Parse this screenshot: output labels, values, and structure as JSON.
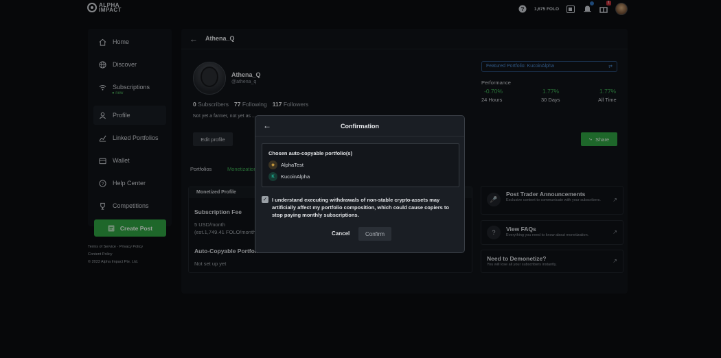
{
  "brand": {
    "line1": "ALPHA",
    "line2": "IMPACT"
  },
  "topbar": {
    "balance": "1,675 FOLO",
    "bell_badge": "1",
    "help_icon": "help-circle-icon",
    "wallet_icon": "wallet-icon",
    "notifications_icon": "bell-icon",
    "gift_icon": "gift-icon"
  },
  "sidebar": {
    "items": [
      {
        "label": "Home",
        "icon": "home-icon"
      },
      {
        "label": "Discover",
        "icon": "globe-icon"
      },
      {
        "label": "Subscriptions",
        "icon": "wifi-icon",
        "sub": "● new"
      },
      {
        "label": "Profile",
        "icon": "user-icon"
      },
      {
        "label": "Linked Portfolios",
        "icon": "chart-line-icon"
      },
      {
        "label": "Wallet",
        "icon": "wallet-icon"
      },
      {
        "label": "Help Center",
        "icon": "help-circle-icon"
      },
      {
        "label": "Competitions",
        "icon": "trophy-icon"
      }
    ],
    "create_post": "Create Post",
    "footer": {
      "terms": "Terms of Service",
      "privacy": "Privacy Policy",
      "content": "Content Policy",
      "copyright": "© 2023 Alpha Impact Pte. Ltd."
    }
  },
  "profile": {
    "header_title": "Athena_Q",
    "name": "Athena_Q",
    "handle": "@athena_q",
    "subscribers_count": "0",
    "subscribers_label": "Subscribers",
    "following_count": "77",
    "following_label": "Following",
    "followers_count": "117",
    "followers_label": "Followers",
    "bio": "Not yet a farmer, not yet as ...",
    "edit_profile": "Edit profile",
    "share": "Share",
    "featured_portfolio": "Featured Portfolio: KucoinAlpha",
    "performance": {
      "title": "Performance",
      "values": [
        "-0.70%",
        "1.77%",
        "1.77%"
      ],
      "labels": [
        "24 Hours",
        "30 Days",
        "All Time"
      ]
    }
  },
  "tabs": {
    "portfolios": "Portfolios",
    "monetization": "Monetization"
  },
  "monetized": {
    "header": "Monetized Profile",
    "fee_title": "Subscription Fee",
    "fee_value": "5 USD/month",
    "fee_est": "(est.1,749.41 FOLO/month)",
    "auto_title": "Auto-Copyable Portfolio",
    "auto_value": "Not set up yet"
  },
  "info_cards": [
    {
      "title": "Post Trader Announcements",
      "desc": "Exclusive content to communicate with your subscribers.",
      "icon": "microphone-icon"
    },
    {
      "title": "View FAQs",
      "desc": "Everything you need to know about monetization.",
      "icon": "question-icon"
    },
    {
      "title": "Need to Demonetize?",
      "desc": "You will lose all your subscribers instantly.",
      "icon": ""
    }
  ],
  "modal": {
    "title": "Confirmation",
    "chosen_title": "Chosen auto-copyable portfolio(s)",
    "portfolios": [
      {
        "name": "AlphaTest",
        "icon_text": "◈",
        "color": "#d9a640"
      },
      {
        "name": "KucoinAlpha",
        "icon_text": "K",
        "color": "#1fb89a"
      }
    ],
    "checkbox_text": "I understand executing withdrawals of non-stable crypto-assets may artificially affect my portfolio composition, which could cause copiers to stop paying monthly subscriptions.",
    "cancel": "Cancel",
    "confirm": "Confirm"
  }
}
